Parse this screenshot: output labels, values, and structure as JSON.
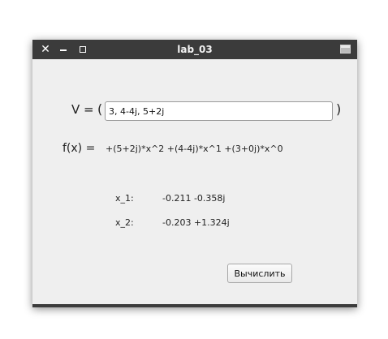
{
  "window": {
    "title": "lab_03",
    "close_glyph": "✕",
    "minimize_glyph": "–"
  },
  "form": {
    "v_label": "V =",
    "paren_open": "(",
    "paren_close": ")",
    "v_value": "3, 4-4j, 5+2j",
    "fx_label": "f(x) =",
    "fx_value": "+(5+2j)*x^2 +(4-4j)*x^1 +(3+0j)*x^0",
    "roots": [
      {
        "name": "x_1:",
        "value": "-0.211 -0.358j"
      },
      {
        "name": "x_2:",
        "value": "-0.203 +1.324j"
      }
    ],
    "compute_label": "Вычислить"
  },
  "icons": {
    "close": "close-icon",
    "minimize": "minimize-icon",
    "maximize": "maximize-icon",
    "window_menu": "window-menu-icon"
  },
  "colors": {
    "titlebar": "#3b3b3b",
    "window_bg": "#efefef"
  }
}
